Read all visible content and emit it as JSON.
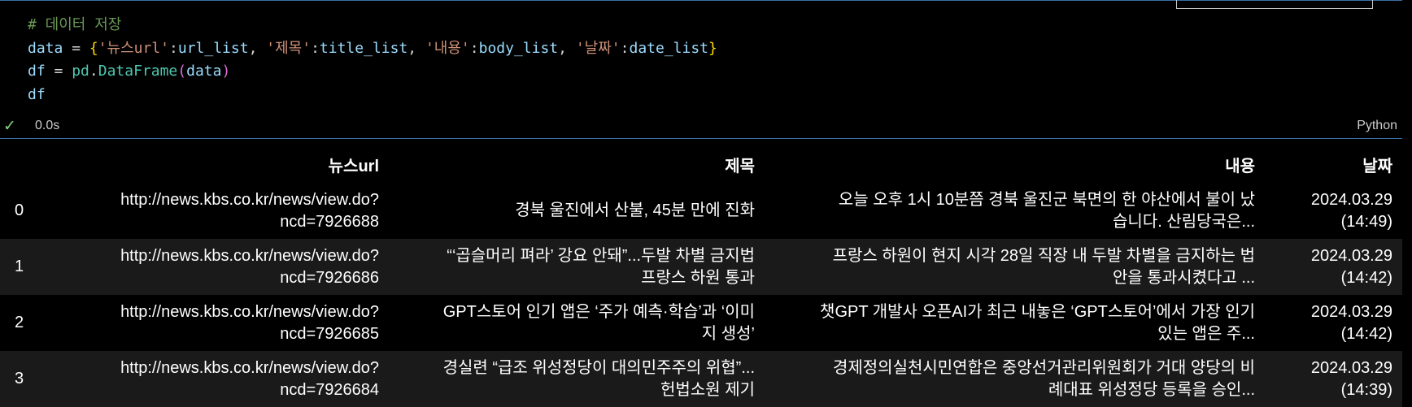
{
  "code_cell": {
    "code_lines": [
      [
        {
          "t": "# 데이터 저장",
          "c": "cmt"
        }
      ],
      [
        {
          "t": "data",
          "c": "var"
        },
        {
          "t": " = ",
          "c": ""
        },
        {
          "t": "{",
          "c": "br1"
        },
        {
          "t": "'뉴스url'",
          "c": "str"
        },
        {
          "t": ":",
          "c": ""
        },
        {
          "t": "url_list",
          "c": "var"
        },
        {
          "t": ", ",
          "c": ""
        },
        {
          "t": "'제목'",
          "c": "str"
        },
        {
          "t": ":",
          "c": ""
        },
        {
          "t": "title_list",
          "c": "var"
        },
        {
          "t": ", ",
          "c": ""
        },
        {
          "t": "'내용'",
          "c": "str"
        },
        {
          "t": ":",
          "c": ""
        },
        {
          "t": "body_list",
          "c": "var"
        },
        {
          "t": ", ",
          "c": ""
        },
        {
          "t": "'날짜'",
          "c": "str"
        },
        {
          "t": ":",
          "c": ""
        },
        {
          "t": "date_list",
          "c": "var"
        },
        {
          "t": "}",
          "c": "br1"
        }
      ],
      [
        {
          "t": "df",
          "c": "var"
        },
        {
          "t": " = ",
          "c": ""
        },
        {
          "t": "pd",
          "c": "cls"
        },
        {
          "t": ".",
          "c": ""
        },
        {
          "t": "DataFrame",
          "c": "cls"
        },
        {
          "t": "(",
          "c": "br2"
        },
        {
          "t": "data",
          "c": "var"
        },
        {
          "t": ")",
          "c": "br2"
        }
      ],
      [
        {
          "t": "df",
          "c": "var"
        }
      ]
    ],
    "status_icon": "check-icon",
    "duration": "0.0s",
    "language": "Python"
  },
  "output_table": {
    "headers": [
      "",
      "뉴스url",
      "제목",
      "내용",
      "날짜"
    ],
    "rows": [
      {
        "index": "0",
        "url_line1": "http://news.kbs.co.kr/news/view.do?",
        "url_line2": "ncd=7926688",
        "title_line1": "경북 울진에서 산불, 45분 만에 진화",
        "title_line2": "",
        "body_line1": "오늘 오후 1시 10분쯤 경북 울진군 북면의 한 야산에서 불이 났",
        "body_line2": "습니다. 산림당국은...",
        "date_line1": "2024.03.29",
        "date_line2": "(14:49)"
      },
      {
        "index": "1",
        "url_line1": "http://news.kbs.co.kr/news/view.do?",
        "url_line2": "ncd=7926686",
        "title_line1": "“‘곱슬머리 펴라’ 강요 안돼”...두발 차별 금지법",
        "title_line2": "프랑스 하원 통과",
        "body_line1": "프랑스 하원이 현지 시각 28일 직장 내 두발 차별을 금지하는 법",
        "body_line2": "안을 통과시켰다고 ...",
        "date_line1": "2024.03.29",
        "date_line2": "(14:42)"
      },
      {
        "index": "2",
        "url_line1": "http://news.kbs.co.kr/news/view.do?",
        "url_line2": "ncd=7926685",
        "title_line1": "GPT스토어 인기 앱은 ‘주가 예측·학습’과 ‘이미",
        "title_line2": "지 생성’",
        "body_line1": "챗GPT 개발사 오픈AI가 최근 내놓은 ‘GPT스토어’에서 가장 인기",
        "body_line2": "있는 앱은 주...",
        "date_line1": "2024.03.29",
        "date_line2": "(14:42)"
      },
      {
        "index": "3",
        "url_line1": "http://news.kbs.co.kr/news/view.do?",
        "url_line2": "ncd=7926684",
        "title_line1": "경실련 “급조 위성정당이 대의민주주의 위협”...",
        "title_line2": "헌법소원 제기",
        "body_line1": "경제정의실천시민연합은 중앙선거관리위원회가 거대 양당의 비",
        "body_line2": "례대표 위성정당 등록을 승인...",
        "date_line1": "2024.03.29",
        "date_line2": "(14:39)"
      }
    ]
  }
}
